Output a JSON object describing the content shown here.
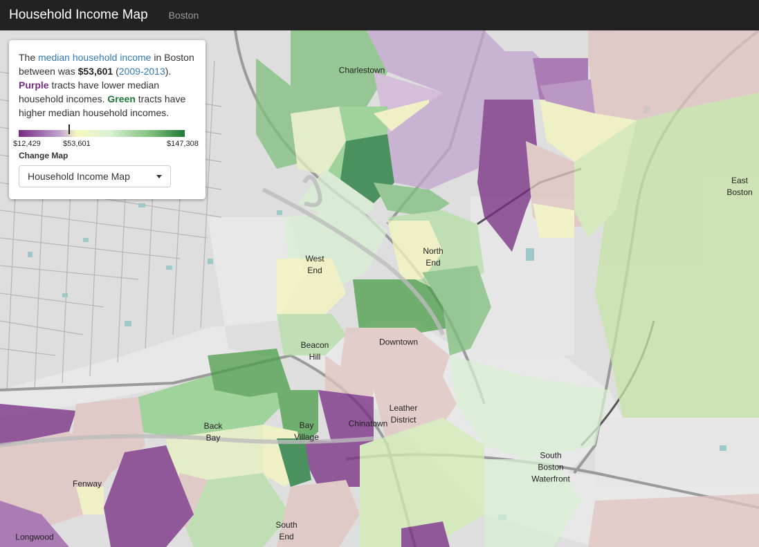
{
  "navbar": {
    "title": "Household Income Map",
    "city": "Boston"
  },
  "panel": {
    "text_1": "The ",
    "link_median": "median household income",
    "text_2": " in Boston between was ",
    "median_value": "$53,601",
    "text_3": " (",
    "link_years": "2009-2013",
    "text_4": "). ",
    "purple_word": "Purple",
    "text_5": " tracts have lower median household incomes. ",
    "green_word": "Green",
    "text_6": " tracts have higher median household incomes.",
    "legend": {
      "min": "$12,429",
      "mid": "$53,601",
      "max": "$147,308",
      "mid_fraction": 0.3
    },
    "change_map_label": "Change Map",
    "select_value": "Household Income Map"
  },
  "colors": {
    "low": "#762a83",
    "mid": "#f7f7c0",
    "high": "#1b7837"
  },
  "labels": [
    {
      "id": "charlestown",
      "text": "Charlestown"
    },
    {
      "id": "east-boston",
      "text": "East\nBoston"
    },
    {
      "id": "north-end",
      "text": "North\nEnd"
    },
    {
      "id": "west-end",
      "text": "West\nEnd"
    },
    {
      "id": "downtown",
      "text": "Downtown"
    },
    {
      "id": "beacon-hill",
      "text": "Beacon\nHill"
    },
    {
      "id": "back-bay",
      "text": "Back\nBay"
    },
    {
      "id": "bay-village",
      "text": "Bay\nVillage"
    },
    {
      "id": "chinatown",
      "text": "Chinatown"
    },
    {
      "id": "leather-district",
      "text": "Leather\nDistrict"
    },
    {
      "id": "south-boston-waterfront",
      "text": "South\nBoston\nWaterfront"
    },
    {
      "id": "fenway",
      "text": "Fenway"
    },
    {
      "id": "south-end",
      "text": "South\nEnd"
    },
    {
      "id": "longwood",
      "text": "Longwood"
    }
  ]
}
